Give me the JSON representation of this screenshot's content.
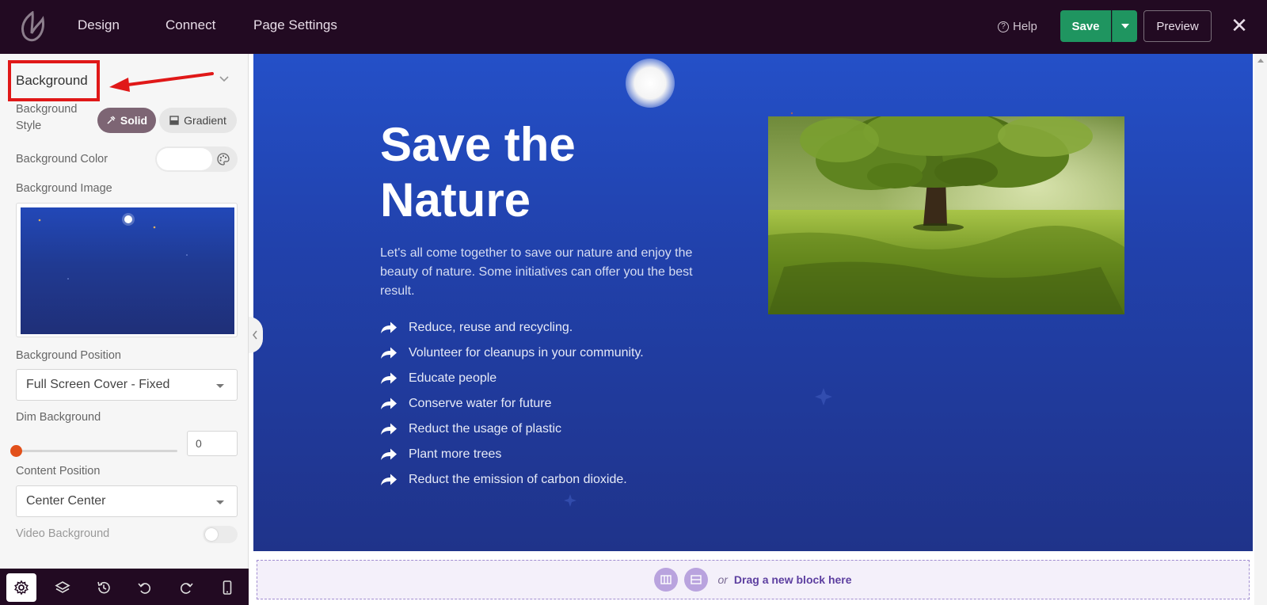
{
  "topbar": {
    "nav": [
      "Design",
      "Connect",
      "Page Settings"
    ],
    "help": "Help",
    "save": "Save",
    "preview": "Preview",
    "close": "✕"
  },
  "sidebar": {
    "section_title": "Background",
    "background_style_label": "Background Style",
    "style_solid": "Solid",
    "style_gradient": "Gradient",
    "background_color_label": "Background Color",
    "background_color_value": "#ffffff",
    "background_image_label": "Background Image",
    "background_position_label": "Background Position",
    "background_position_value": "Full Screen Cover - Fixed",
    "dim_background_label": "Dim Background",
    "dim_background_value": "0",
    "content_position_label": "Content Position",
    "content_position_value": "Center Center",
    "video_background_label": "Video Background",
    "video_background_on": false
  },
  "bottombar": {
    "icons": [
      "settings-icon",
      "layers-icon",
      "history-icon",
      "undo-icon",
      "redo-icon",
      "mobile-icon"
    ]
  },
  "canvas": {
    "title": "Save the Nature",
    "description": "Let's all come together to save our nature and enjoy the beauty of nature. Some initiatives can offer you the best result.",
    "bullets": [
      "Reduce, reuse and recycling.",
      "Volunteer for cleanups in your community.",
      "Educate people",
      "Conserve water for future",
      "Reduct the usage of plastic",
      "Plant more trees",
      "Reduct the emission of carbon dioxide."
    ]
  },
  "dropzone": {
    "or": "or",
    "text": "Drag a new block here"
  },
  "colors": {
    "topbar_bg": "#220a22",
    "save_green": "#1f9560",
    "canvas_blue": "#2141ab",
    "accent_red": "#e01818",
    "slider_orange": "#e2501a"
  }
}
